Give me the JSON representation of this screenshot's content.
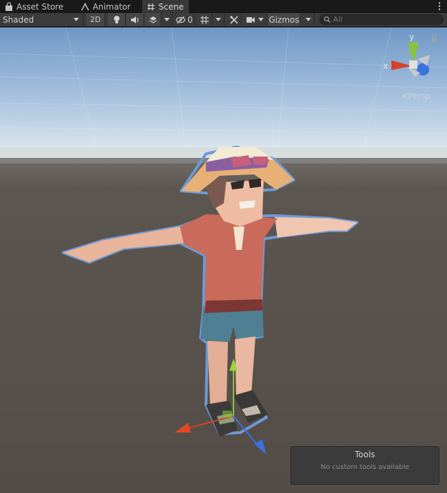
{
  "tabs": [
    {
      "label": "Asset Store",
      "icon": "shopping-bag-icon"
    },
    {
      "label": "Animator",
      "icon": "animator-icon"
    },
    {
      "label": "Scene",
      "icon": "grid-hash-icon",
      "active": true
    }
  ],
  "toolbar": {
    "draw_mode": "Shaded",
    "mode_2d": "2D",
    "hidden_count": "0",
    "gizmos_label": "Gizmos",
    "search_placeholder": "All"
  },
  "gizmo": {
    "x_label": "x",
    "y_label": "y",
    "projection": "Persp"
  },
  "tools_overlay": {
    "title": "Tools",
    "message": "No custom tools available"
  },
  "colors": {
    "x_axis": "#d8402a",
    "y_axis": "#8ac43a",
    "z_axis": "#3b72e0",
    "selection_outline": "#6e9ad6"
  }
}
